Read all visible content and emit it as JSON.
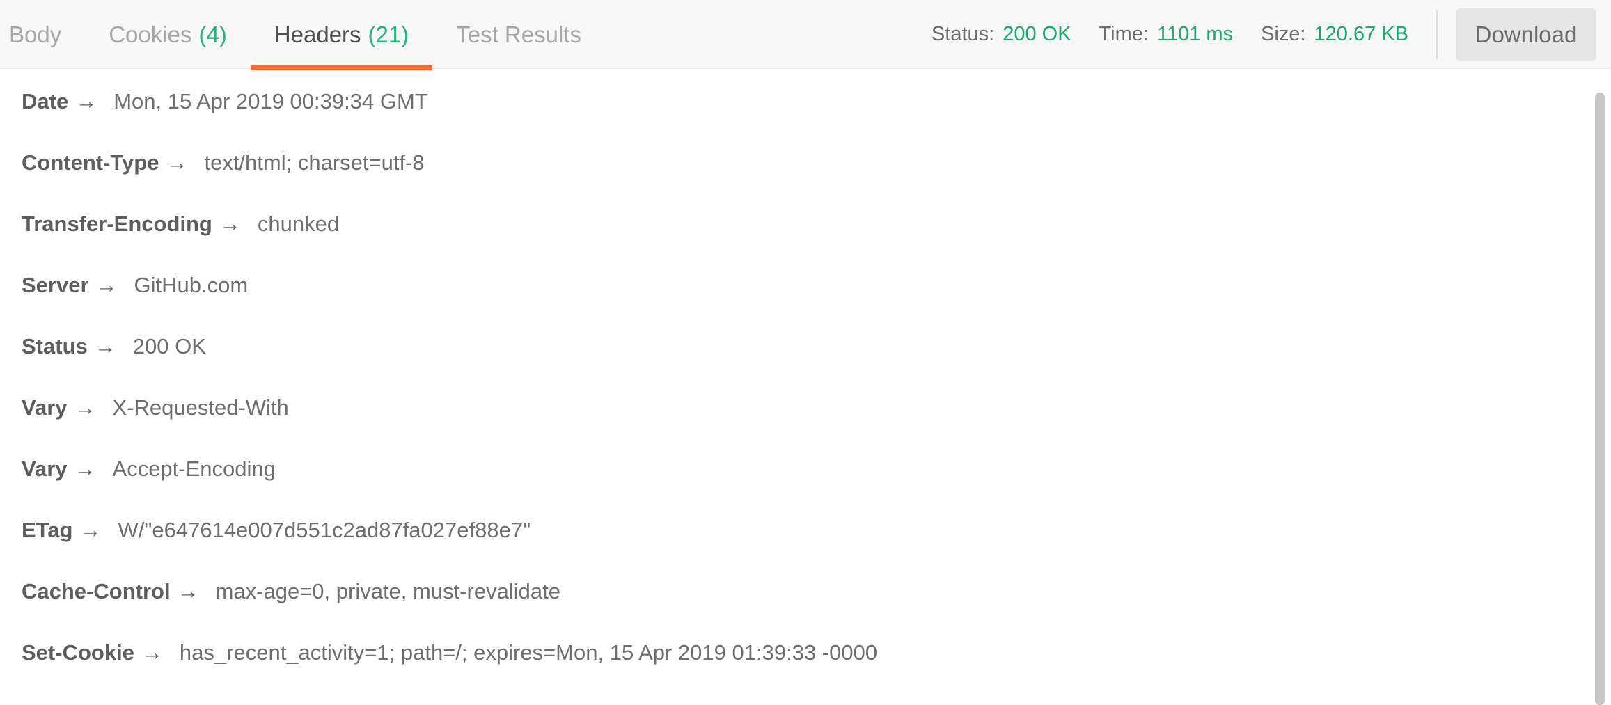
{
  "tabs": [
    {
      "label": "Body",
      "count": ""
    },
    {
      "label": "Cookies",
      "count": "(4)"
    },
    {
      "label": "Headers",
      "count": "(21)"
    },
    {
      "label": "Test Results",
      "count": ""
    }
  ],
  "active_tab": "Headers",
  "status": {
    "label": "Status:",
    "value": "200 OK"
  },
  "time": {
    "label": "Time:",
    "value": "1101 ms"
  },
  "size": {
    "label": "Size:",
    "value": "120.67 KB"
  },
  "download_label": "Download",
  "arrow_glyph": "→",
  "headers": [
    {
      "key": "Date",
      "value": "Mon, 15 Apr 2019 00:39:34 GMT"
    },
    {
      "key": "Content-Type",
      "value": "text/html; charset=utf-8"
    },
    {
      "key": "Transfer-Encoding",
      "value": "chunked"
    },
    {
      "key": "Server",
      "value": "GitHub.com"
    },
    {
      "key": "Status",
      "value": "200 OK"
    },
    {
      "key": "Vary",
      "value": "X-Requested-With"
    },
    {
      "key": "Vary",
      "value": "Accept-Encoding"
    },
    {
      "key": "ETag",
      "value": "W/\"e647614e007d551c2ad87fa027ef88e7\""
    },
    {
      "key": "Cache-Control",
      "value": "max-age=0, private, must-revalidate"
    },
    {
      "key": "Set-Cookie",
      "value": "has_recent_activity=1; path=/; expires=Mon, 15 Apr 2019 01:39:33 -0000"
    }
  ],
  "colors": {
    "accent_orange": "#f26b3a",
    "status_green": "#1aa86e"
  }
}
